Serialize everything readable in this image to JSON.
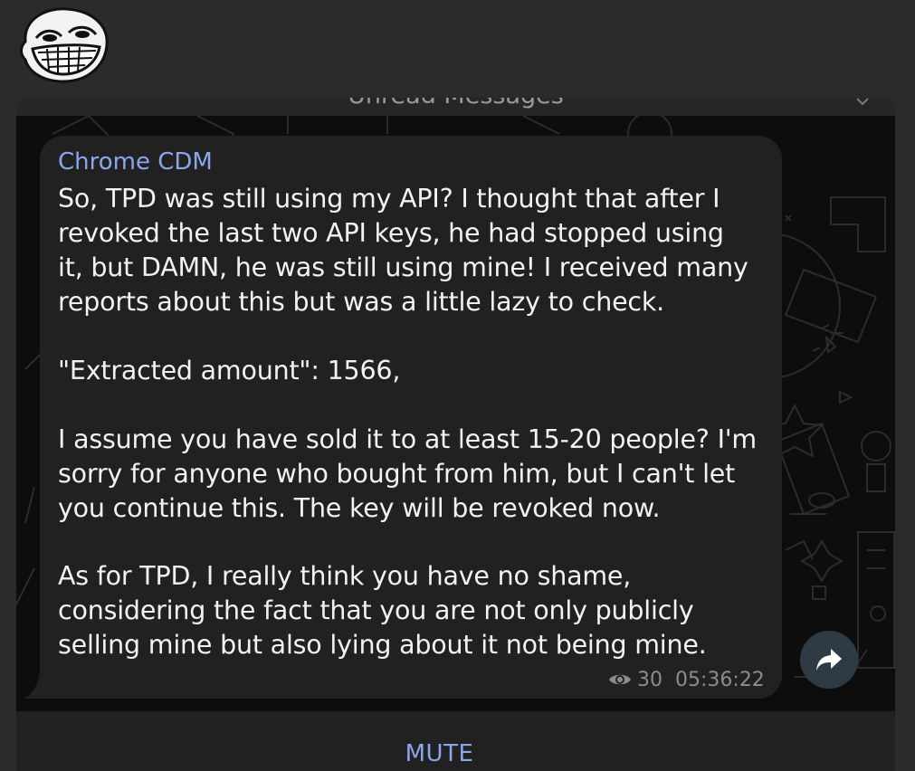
{
  "header": {
    "avatar_icon": "trollface-avatar-icon"
  },
  "chat": {
    "unread_divider": "Unread Messages",
    "scroll_down_icon": "chevron-down-icon"
  },
  "message": {
    "sender": "Chrome CDM",
    "lines": [
      "So, TPD was still using my API? I thought that after I",
      "revoked the last two API keys, he had stopped using",
      "it, but DAMN, he was still using mine! I received many",
      "reports about this but was a little lazy to check.",
      "\"Extracted amount\": 1566,",
      "I assume you have sold it to at least 15-20 people? I'm",
      "sorry for anyone who bought from him, but I can't let",
      "you continue this. The key will be revoked now.",
      "As for TPD, I really think you have no shame,",
      "considering the fact that you are not only publicly",
      "selling mine but also lying about it not being mine."
    ],
    "views": "30",
    "time": "05:36:22",
    "views_icon": "eye-icon",
    "forward_icon": "forward-arrow-icon"
  },
  "footer": {
    "mute_label": "MUTE"
  },
  "colors": {
    "accent": "#8ba6ea",
    "bubble": "#212121",
    "chat_bg": "#0d0d0d",
    "text": "#f2f2f2"
  }
}
